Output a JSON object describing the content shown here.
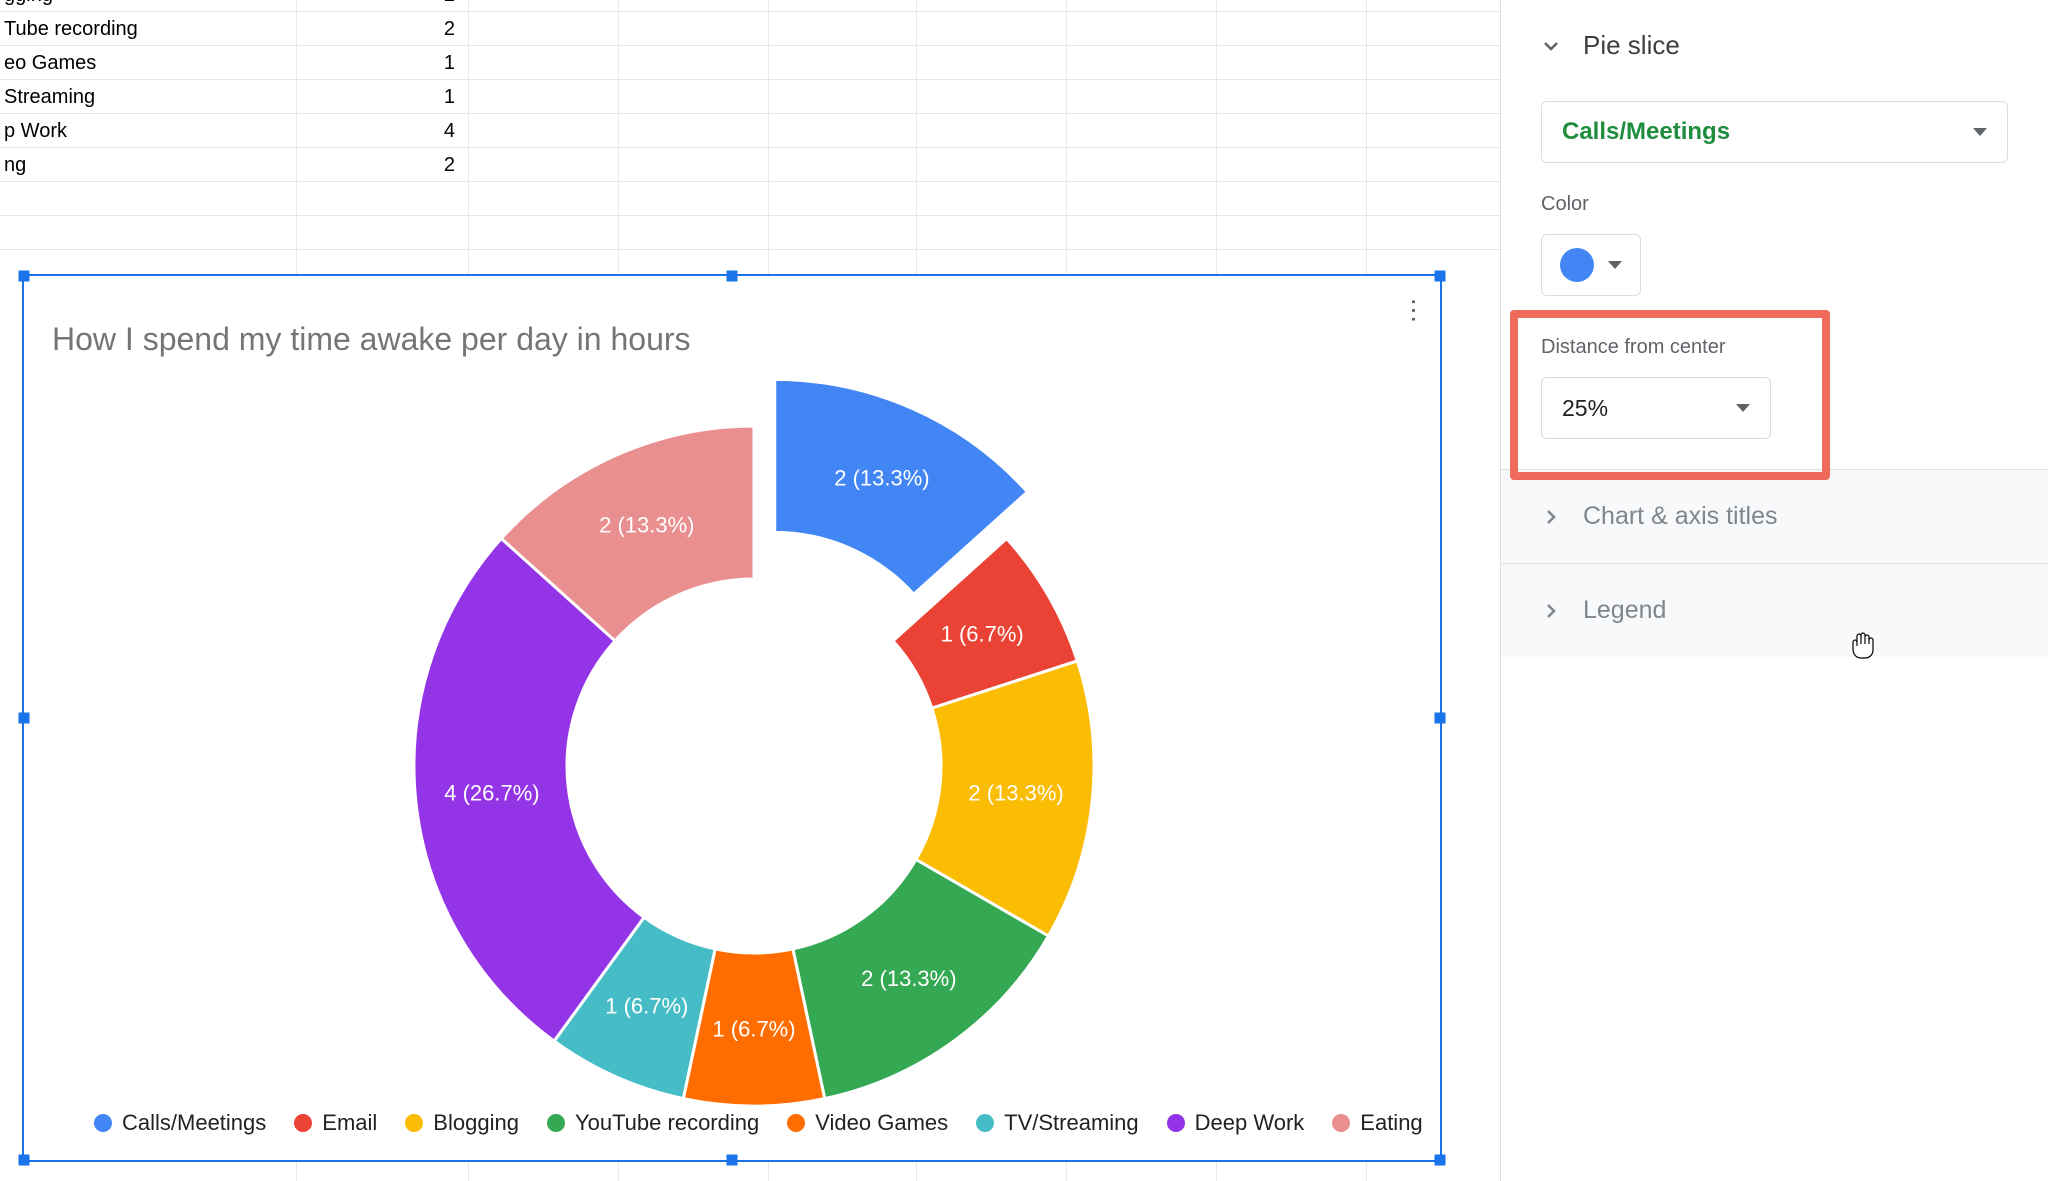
{
  "spreadsheet": {
    "rows": [
      {
        "a": "gging",
        "b": "2"
      },
      {
        "a": "Tube recording",
        "b": "2"
      },
      {
        "a": "eo Games",
        "b": "1"
      },
      {
        "a": "Streaming",
        "b": "1"
      },
      {
        "a": "p Work",
        "b": "4"
      },
      {
        "a": "ng",
        "b": "2"
      }
    ]
  },
  "chart": {
    "title": "How I spend my time awake per day in hours",
    "legend": [
      {
        "label": "Calls/Meetings",
        "color": "#4285f4"
      },
      {
        "label": "Email",
        "color": "#ea4335"
      },
      {
        "label": "Blogging",
        "color": "#fbbc04"
      },
      {
        "label": "YouTube recording",
        "color": "#34a853"
      },
      {
        "label": "Video Games",
        "color": "#ff6d01"
      },
      {
        "label": "TV/Streaming",
        "color": "#46bdc6"
      },
      {
        "label": "Deep Work",
        "color": "#9334e6"
      },
      {
        "label": "Eating",
        "color": "#ea8f8f"
      }
    ],
    "slice_labels": [
      "2 (13.3%)",
      "1 (6.7%)",
      "2 (13.3%)",
      "2 (13.3%)",
      "1 (6.7%)",
      "1 (6.7%)",
      "4 (26.7%)",
      "2 (13.3%)"
    ]
  },
  "panel": {
    "pie_slice_title": "Pie slice",
    "slice_selected": "Calls/Meetings",
    "color_label": "Color",
    "color_value": "#4285f4",
    "distance_label": "Distance from center",
    "distance_value": "25%",
    "section_titles": "Chart & axis titles",
    "section_legend": "Legend"
  },
  "chart_data": {
    "type": "pie",
    "title": "How I spend my time awake per day in hours",
    "donut_hole": 0.55,
    "exploded_slice": {
      "index": 0,
      "distance_percent": 25
    },
    "categories": [
      "Calls/Meetings",
      "Email",
      "Blogging",
      "YouTube recording",
      "Video Games",
      "TV/Streaming",
      "Deep Work",
      "Eating"
    ],
    "values": [
      2,
      1,
      2,
      2,
      1,
      1,
      4,
      2
    ],
    "percent": [
      13.3,
      6.7,
      13.3,
      13.3,
      6.7,
      6.7,
      26.7,
      13.3
    ],
    "colors": [
      "#4285f4",
      "#ea4335",
      "#fbbc04",
      "#34a853",
      "#ff6d01",
      "#46bdc6",
      "#9334e6",
      "#ea8f8f"
    ],
    "legend_position": "bottom",
    "xlabel": "",
    "ylabel": ""
  }
}
